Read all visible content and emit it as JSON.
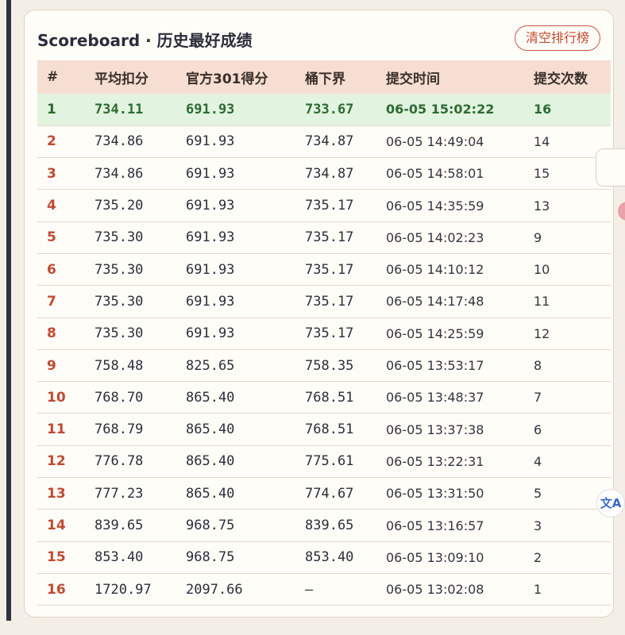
{
  "header": {
    "title": "Scoreboard · 历史最好成绩",
    "clear_label": "清空排行榜"
  },
  "table": {
    "columns": [
      "#",
      "平均扣分",
      "官方301得分",
      "桶下界",
      "提交时间",
      "提交次数"
    ],
    "rows": [
      [
        "1",
        "734.11",
        "691.93",
        "733.67",
        "06-05 15:02:22",
        "16"
      ],
      [
        "2",
        "734.86",
        "691.93",
        "734.87",
        "06-05 14:49:04",
        "14"
      ],
      [
        "3",
        "734.86",
        "691.93",
        "734.87",
        "06-05 14:58:01",
        "15"
      ],
      [
        "4",
        "735.20",
        "691.93",
        "735.17",
        "06-05 14:35:59",
        "13"
      ],
      [
        "5",
        "735.30",
        "691.93",
        "735.17",
        "06-05 14:02:23",
        "9"
      ],
      [
        "6",
        "735.30",
        "691.93",
        "735.17",
        "06-05 14:10:12",
        "10"
      ],
      [
        "7",
        "735.30",
        "691.93",
        "735.17",
        "06-05 14:17:48",
        "11"
      ],
      [
        "8",
        "735.30",
        "691.93",
        "735.17",
        "06-05 14:25:59",
        "12"
      ],
      [
        "9",
        "758.48",
        "825.65",
        "758.35",
        "06-05 13:53:17",
        "8"
      ],
      [
        "10",
        "768.70",
        "865.40",
        "768.51",
        "06-05 13:48:37",
        "7"
      ],
      [
        "11",
        "768.79",
        "865.40",
        "768.51",
        "06-05 13:37:38",
        "6"
      ],
      [
        "12",
        "776.78",
        "865.40",
        "775.61",
        "06-05 13:22:31",
        "4"
      ],
      [
        "13",
        "777.23",
        "865.40",
        "774.67",
        "06-05 13:31:50",
        "5"
      ],
      [
        "14",
        "839.65",
        "968.75",
        "839.65",
        "06-05 13:16:57",
        "3"
      ],
      [
        "15",
        "853.40",
        "968.75",
        "853.40",
        "06-05 13:09:10",
        "2"
      ],
      [
        "16",
        "1720.97",
        "2097.66",
        "—",
        "06-05 13:02:08",
        "1"
      ]
    ]
  },
  "translate_label": "文A",
  "colors": {
    "accent": "#c04a33",
    "best_row_bg": "#e2f3df",
    "best_row_text": "#2c6b33",
    "header_bg": "#f6dfd2"
  }
}
